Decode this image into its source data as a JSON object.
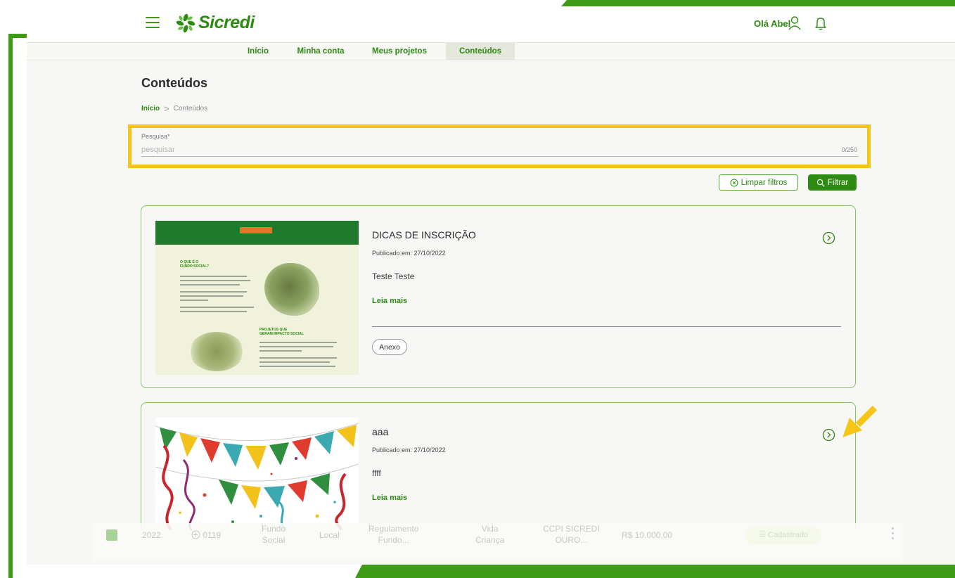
{
  "header": {
    "brand": "Sicredi",
    "greeting": "Olá Abel"
  },
  "nav": {
    "tabs": [
      {
        "label": "Início",
        "active": false
      },
      {
        "label": "Minha conta",
        "active": false
      },
      {
        "label": "Meus projetos",
        "active": false
      },
      {
        "label": "Conteúdos",
        "active": true
      }
    ]
  },
  "page": {
    "title": "Conteúdos",
    "breadcrumb": {
      "home": "Início",
      "separator": ">",
      "current": "Conteúdos"
    }
  },
  "search": {
    "label": "Pesquisa*",
    "placeholder": "pesquisar",
    "value": "",
    "counter": "0/250"
  },
  "filters": {
    "clear_label": "Limpar filtros",
    "filter_label": "Filtrar"
  },
  "cards": [
    {
      "title": "DICAS DE INSCRIÇÃO",
      "published": "Publicado em: 27/10/2022",
      "description": "Teste Teste",
      "more_label": "Leia mais",
      "attachment_label": "Anexo"
    },
    {
      "title": "aaa",
      "published": "Publicado em: 27/10/2022",
      "description": "ffff",
      "more_label": "Leia mais"
    }
  ],
  "thumbnail1": {
    "heading1": "O QUE É O\nFUNDO SOCIAL?",
    "heading2": "PROJETOS QUE\nGERAM IMPACTO SOCIAL"
  },
  "background_row": {
    "year": "2022",
    "id": "0119",
    "type": "Fundo\nSocial",
    "scope": "Local",
    "regulation": "Regulamento\nFundo...",
    "project": "Vida\nCriança",
    "cooperative": "CCPI SICREDI\nOURO...",
    "amount": "R$ 10.000,00",
    "status": "Cadastrado"
  },
  "colors": {
    "brand_green": "#2d8a12",
    "frame_green": "#3f9b16",
    "highlight_yellow": "#f5c518",
    "card_border": "#82c45f"
  }
}
